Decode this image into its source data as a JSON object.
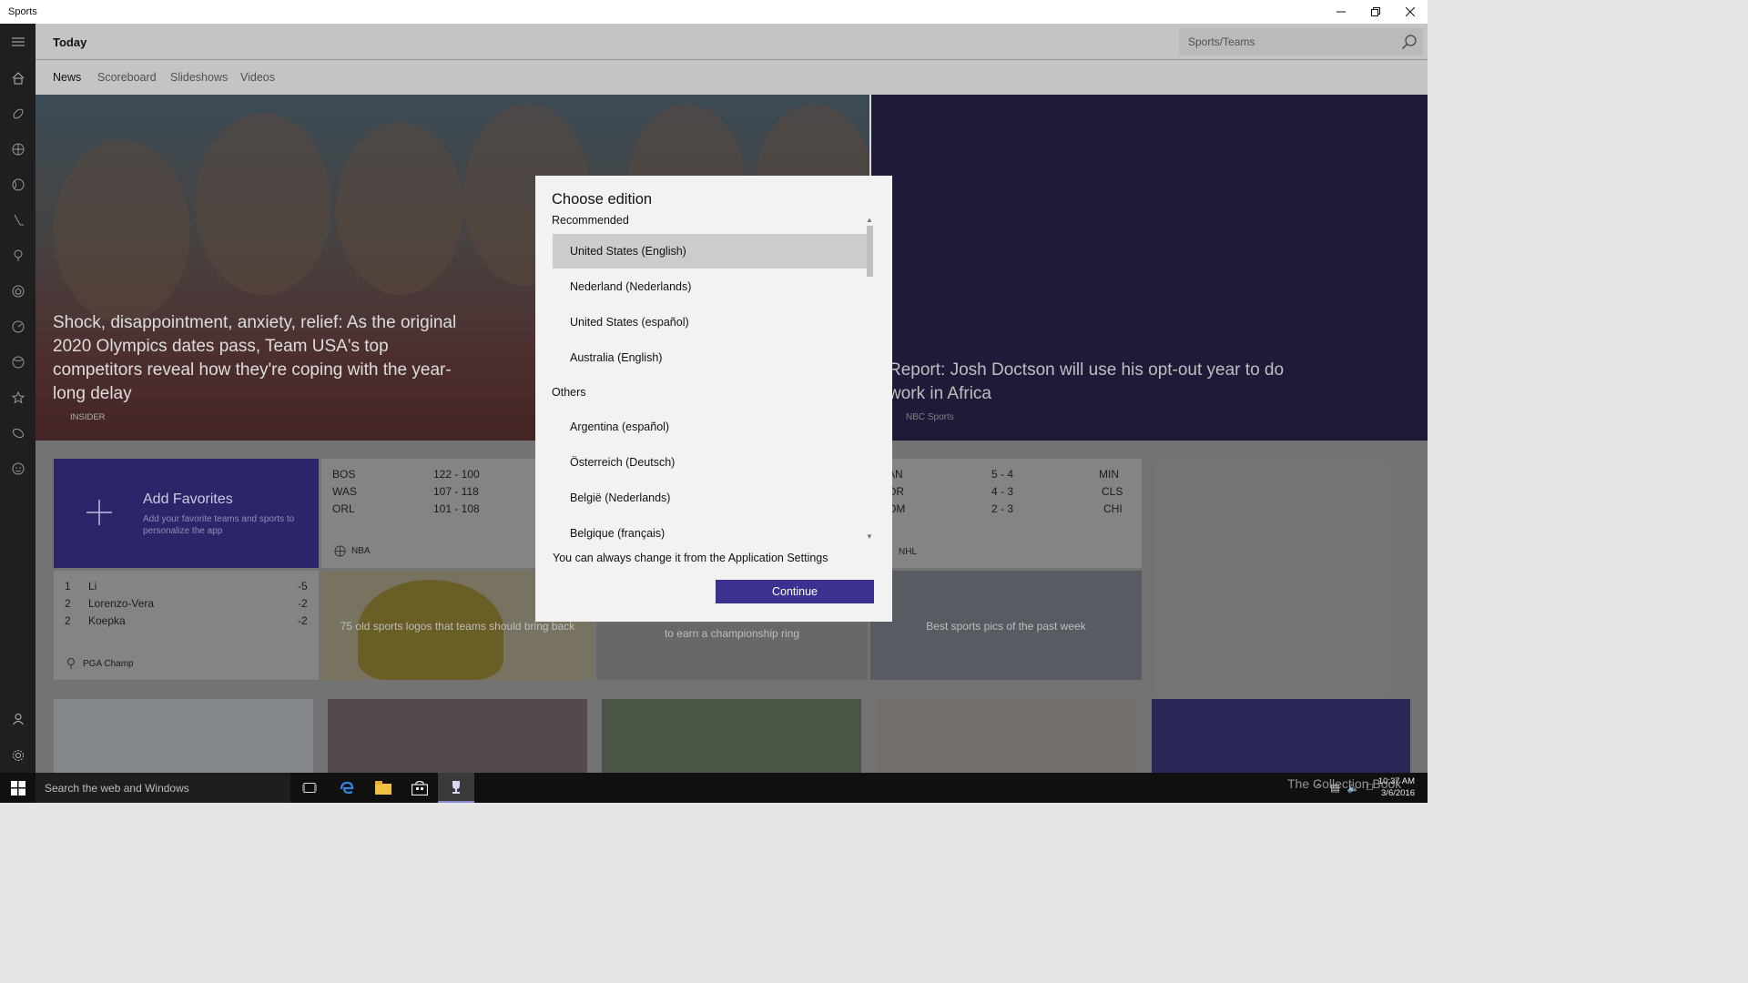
{
  "window": {
    "title": "Sports"
  },
  "header": {
    "page_title": "Today",
    "search_placeholder": "Sports/Teams"
  },
  "tabs": [
    {
      "label": "News"
    },
    {
      "label": "Scoreboard"
    },
    {
      "label": "Slideshows"
    },
    {
      "label": "Videos"
    }
  ],
  "hero": [
    {
      "headline": "Shock, disappointment, anxiety, relief: As the original 2020 Olympics dates pass, Team USA's top competitors reveal how they're coping with the year-long delay",
      "source": "INSIDER"
    },
    {
      "headline": "Report: Josh Doctson will use his opt-out year to do work in Africa",
      "source": "NBC Sports"
    }
  ],
  "add_favorites": {
    "title": "Add Favorites",
    "desc": "Add your favorite teams and sports to personalize the app"
  },
  "nba": {
    "rows": [
      {
        "team": "BOS",
        "score": "122 - 100"
      },
      {
        "team": "WAS",
        "score": "107 - 118"
      },
      {
        "team": "ORL",
        "score": "101 - 108"
      }
    ],
    "league": "NBA"
  },
  "nhl": {
    "rows": [
      {
        "team": "AN",
        "score": "5 - 4",
        "opp": "MIN"
      },
      {
        "team": "OR",
        "score": "4 - 3",
        "opp": "CLS"
      },
      {
        "team": "OM",
        "score": "2 - 3",
        "opp": "CHI"
      }
    ],
    "league": "NHL"
  },
  "golf": {
    "rows": [
      {
        "pos": "1",
        "name": "Li",
        "score": "-5"
      },
      {
        "pos": "2",
        "name": "Lorenzo-Vera",
        "score": "-2"
      },
      {
        "pos": "2",
        "name": "Koepka",
        "score": "-2"
      }
    ],
    "event": "PGA Champ"
  },
  "photo_tiles": [
    {
      "caption": "75 old sports logos that teams should bring back"
    },
    {
      "caption": "to earn a championship ring"
    },
    {
      "caption": "Best sports pics of the past week"
    }
  ],
  "dialog": {
    "title": "Choose edition",
    "recommended_label": "Recommended",
    "recommended": [
      {
        "label": "United States (English)",
        "selected": true
      },
      {
        "label": "Nederland (Nederlands)"
      },
      {
        "label": "United States (español)"
      },
      {
        "label": "Australia (English)"
      }
    ],
    "others_label": "Others",
    "others": [
      {
        "label": "Argentina (español)"
      },
      {
        "label": "Österreich (Deutsch)"
      },
      {
        "label": "België (Nederlands)"
      },
      {
        "label": "Belgique (français)"
      }
    ],
    "note": "You can always change it from the Application Settings",
    "continue_label": "Continue"
  },
  "taskbar": {
    "search_placeholder": "Search the web and Windows",
    "watermark": "The Collection Book",
    "time": "10:37 AM",
    "date": "3/6/2016"
  },
  "colors": {
    "accent": "#3a3191",
    "rail": "#1f1f1f",
    "taskbar": "#101010"
  }
}
